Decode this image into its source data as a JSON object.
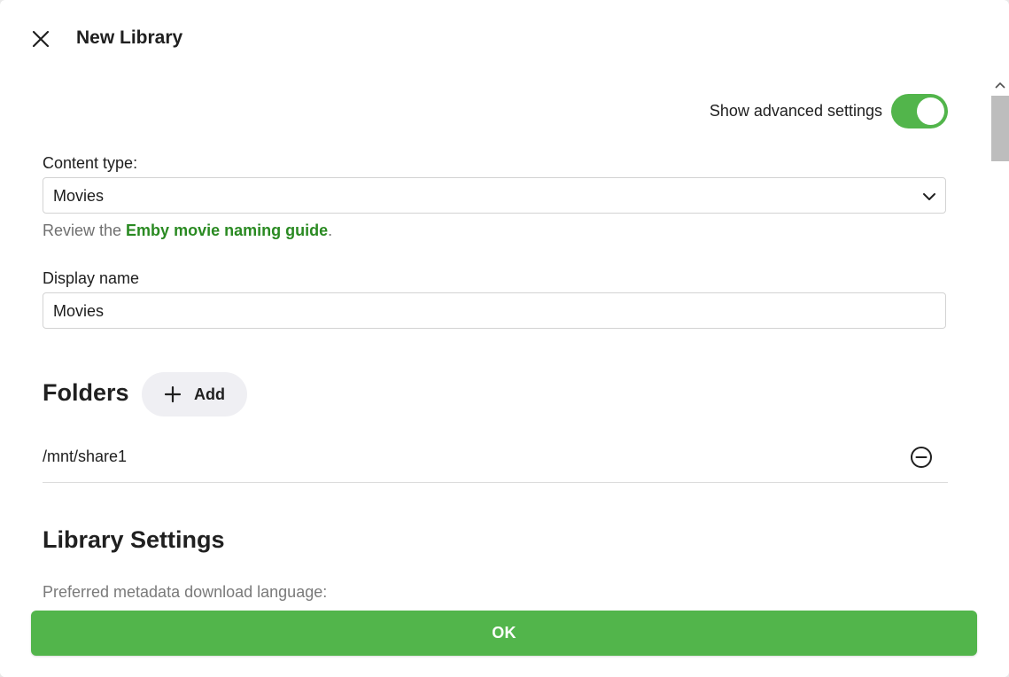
{
  "dialog": {
    "title": "New Library",
    "close_icon": "close-icon"
  },
  "advanced": {
    "label": "Show advanced settings",
    "enabled": true,
    "accent": "#52b54b"
  },
  "content_type": {
    "label": "Content type:",
    "value": "Movies",
    "guide_prefix": "Review the ",
    "guide_link": "Emby movie naming guide",
    "guide_suffix": "."
  },
  "display_name": {
    "label": "Display name",
    "value": "Movies"
  },
  "folders": {
    "title": "Folders",
    "add_label": "Add",
    "items": [
      {
        "path": "/mnt/share1"
      }
    ]
  },
  "library_settings": {
    "title": "Library Settings",
    "cut_text": "Preferred metadata download language:"
  },
  "footer": {
    "ok_label": "OK"
  }
}
